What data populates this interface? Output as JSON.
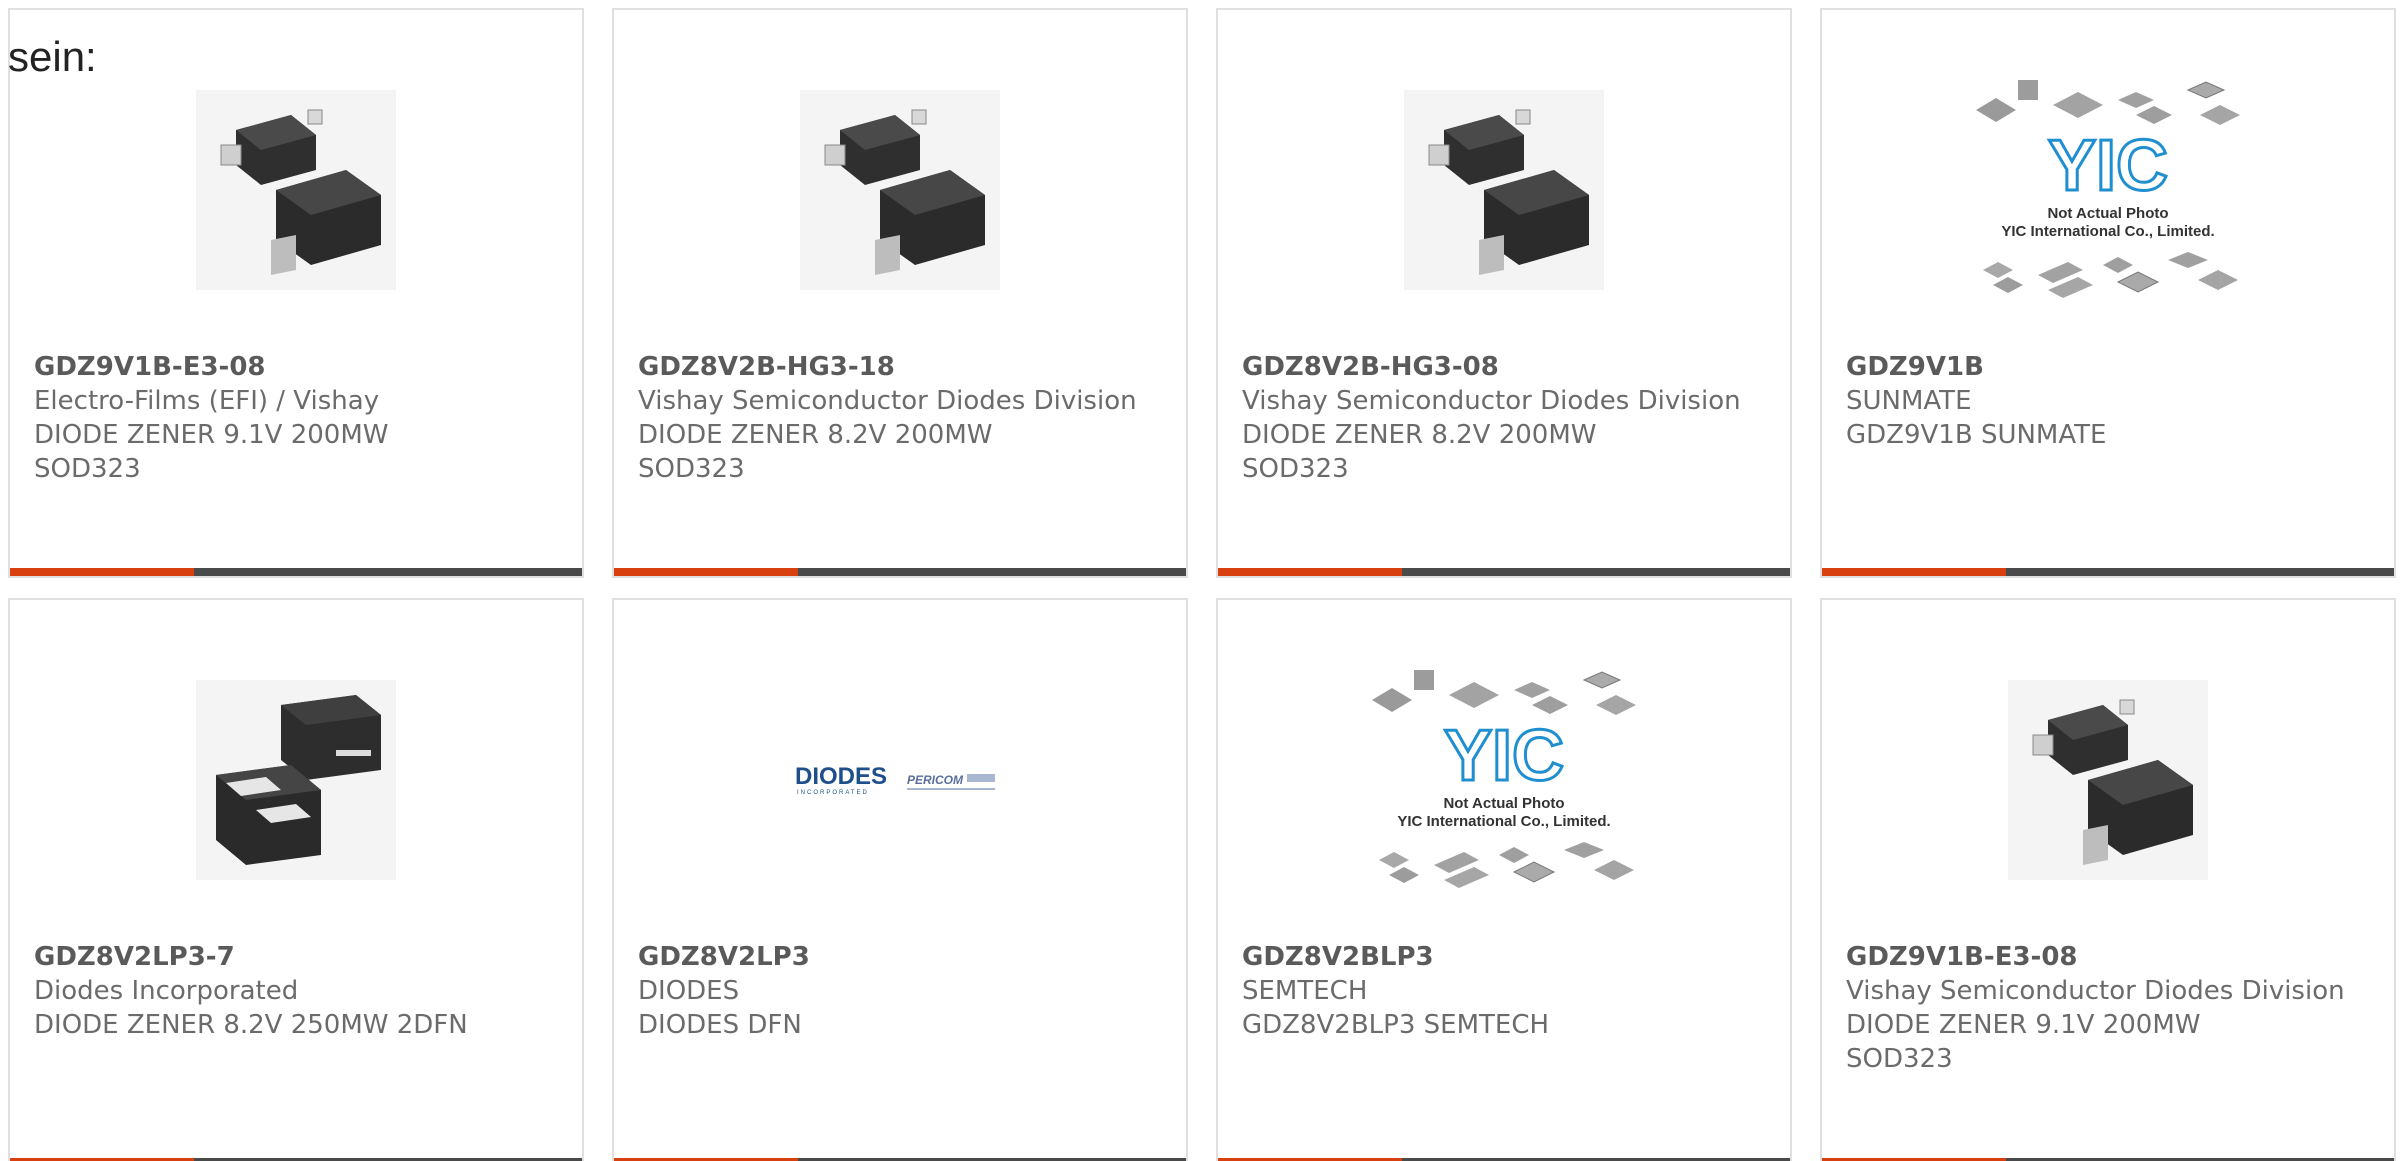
{
  "intro_text": "sein:",
  "products": [
    {
      "part": "GDZ9V1B-E3-08",
      "maker": "Electro-Films (EFI) / Vishay",
      "desc_lines": [
        "DIODE ZENER 9.1V 200MW",
        "SOD323"
      ],
      "image": "sod323-package"
    },
    {
      "part": "GDZ8V2B-HG3-18",
      "maker": "Vishay Semiconductor Diodes Division",
      "desc_lines": [
        "DIODE ZENER 8.2V 200MW",
        "SOD323"
      ],
      "image": "sod323-package"
    },
    {
      "part": "GDZ8V2B-HG3-08",
      "maker": "Vishay Semiconductor Diodes Division",
      "desc_lines": [
        "DIODE ZENER 8.2V 200MW",
        "SOD323"
      ],
      "image": "sod323-package"
    },
    {
      "part": "GDZ9V1B",
      "maker": "SUNMATE",
      "desc_lines": [
        "GDZ9V1B SUNMATE"
      ],
      "image": "yic-placeholder"
    },
    {
      "part": "GDZ8V2LP3-7",
      "maker": "Diodes Incorporated",
      "desc_lines": [
        "DIODE ZENER 8.2V 250MW 2DFN"
      ],
      "image": "dfn-package"
    },
    {
      "part": "GDZ8V2LP3",
      "maker": "DIODES",
      "desc_lines": [
        "DIODES DFN"
      ],
      "image": "diodes-logo"
    },
    {
      "part": "GDZ8V2BLP3",
      "maker": "SEMTECH",
      "desc_lines": [
        "GDZ8V2BLP3 SEMTECH"
      ],
      "image": "yic-placeholder"
    },
    {
      "part": "GDZ9V1B-E3-08",
      "maker": "Vishay Semiconductor Diodes Division",
      "desc_lines": [
        "DIODE ZENER 9.1V 200MW",
        "SOD323"
      ],
      "image": "sod323-package"
    }
  ],
  "yic_placeholder": {
    "logo_text": "YIC",
    "line1": "Not Actual Photo",
    "line2": "YIC International Co., Limited."
  },
  "diodes_logo": {
    "brand": "DIODES",
    "tagline": "INCORPORATED",
    "partner": "PERICOM"
  },
  "colors": {
    "accent": "#d9400f",
    "bar": "#4a4a4a",
    "text": "#6b6b6b",
    "border": "#e0e0e0"
  }
}
